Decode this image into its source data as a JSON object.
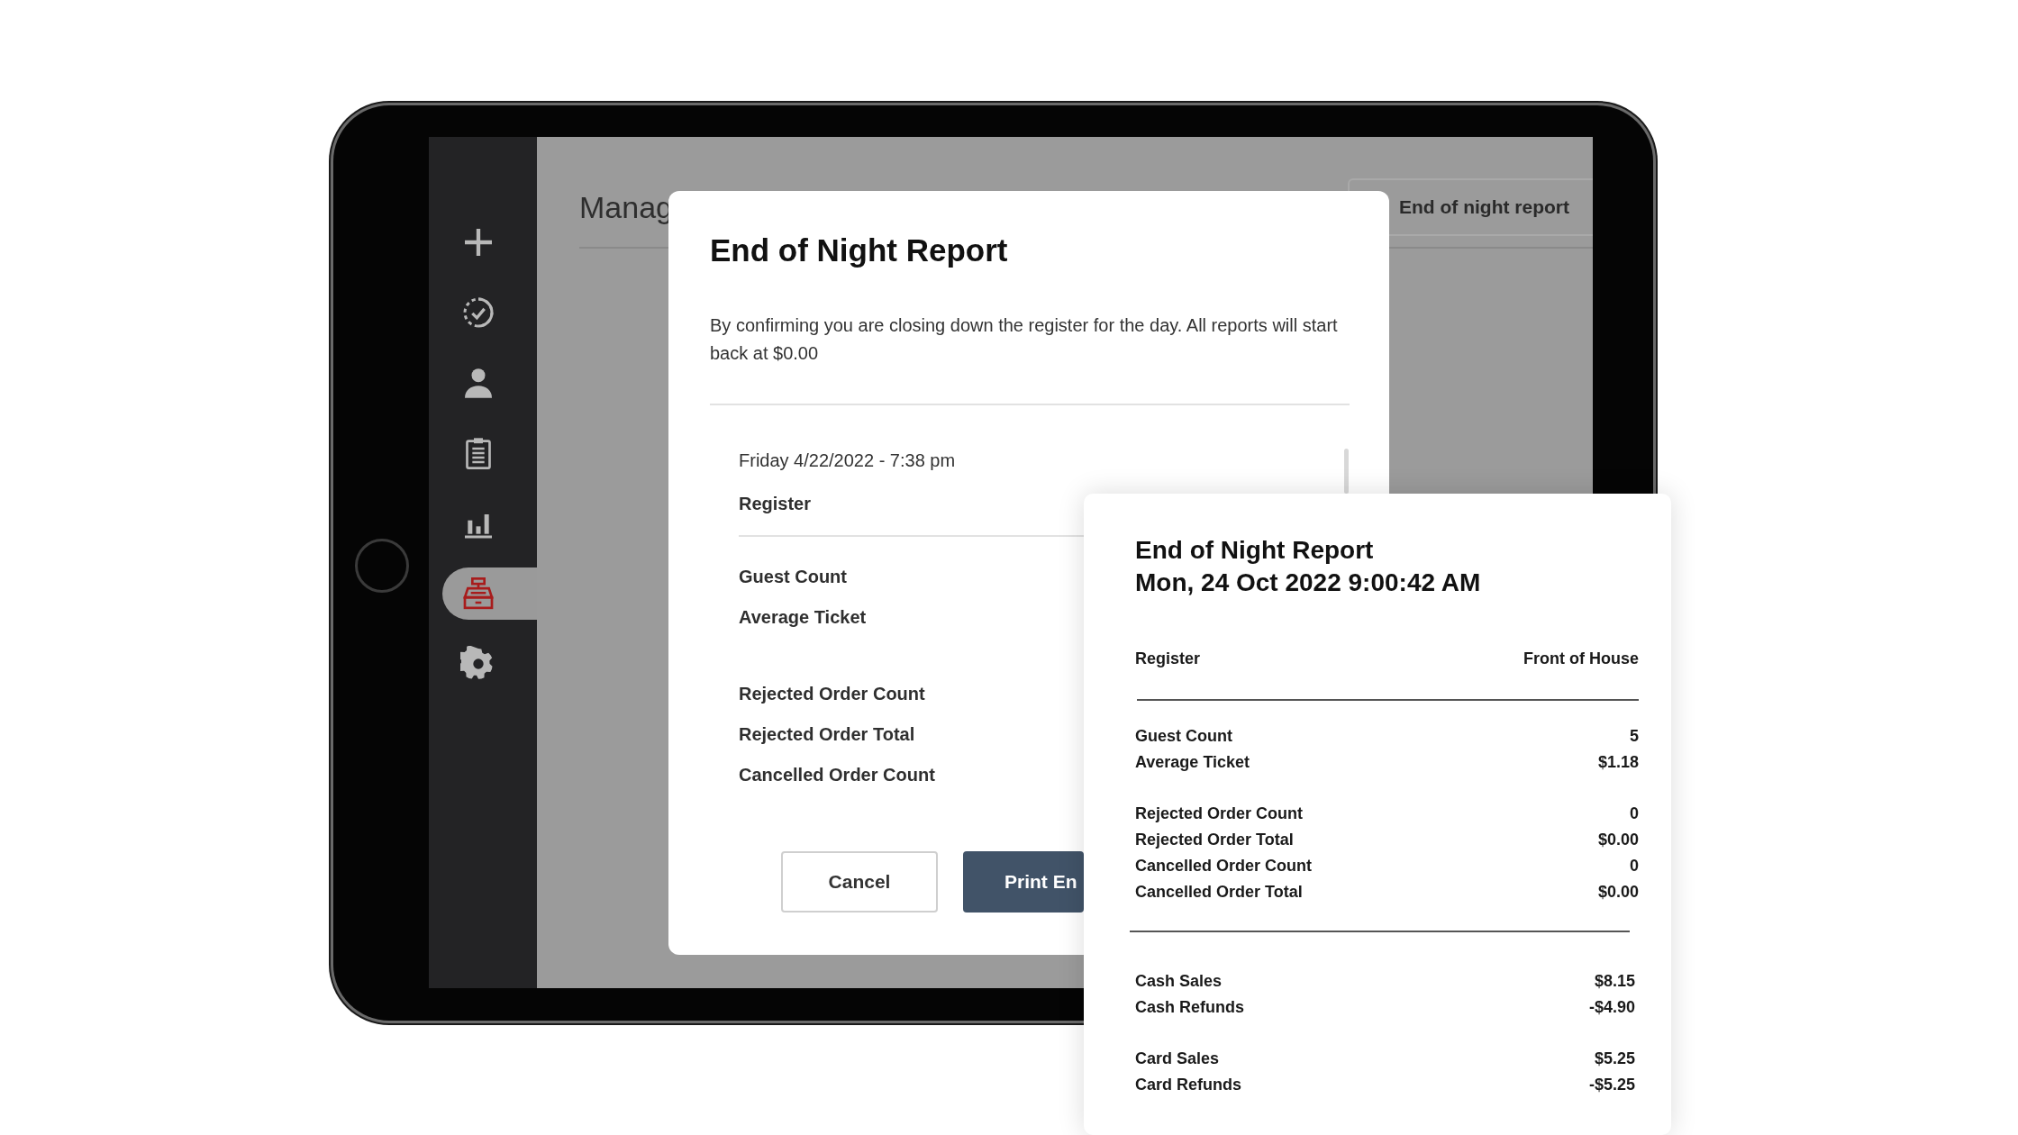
{
  "sidebar": {
    "items": [
      {
        "kind": "plus",
        "selected": false
      },
      {
        "kind": "progress",
        "selected": false
      },
      {
        "kind": "person",
        "selected": false
      },
      {
        "kind": "clipboard",
        "selected": false
      },
      {
        "kind": "chart",
        "selected": false
      },
      {
        "kind": "register",
        "selected": true
      },
      {
        "kind": "gear",
        "selected": false
      }
    ]
  },
  "page": {
    "title": "Manag",
    "action_button": "End of night report"
  },
  "modal": {
    "title": "End of Night Report",
    "message": "By confirming you are closing down the register for the day. All reports will start back at $0.00",
    "date": "Friday 4/22/2022 - 7:38 pm",
    "register_label": "Register",
    "groups": [
      [
        "Guest Count",
        "Average Ticket"
      ],
      [
        "Rejected Order Count",
        "Rejected Order Total",
        "Cancelled Order Count"
      ]
    ],
    "buttons": [
      {
        "label": "Cancel",
        "kind": "secondary"
      },
      {
        "label": "Print En",
        "kind": "primary"
      }
    ]
  },
  "receipt": {
    "title": "End of Night Report",
    "timestamp": "Mon, 24 Oct 2022 9:00:42 AM",
    "register": {
      "label": "Register",
      "value": "Front of House"
    },
    "sections": [
      {
        "groups": [
          [
            {
              "label": "Guest Count",
              "value": "5"
            },
            {
              "label": "Average Ticket",
              "value": "$1.18"
            }
          ],
          [
            {
              "label": "Rejected Order Count",
              "value": "0"
            },
            {
              "label": "Rejected Order Total",
              "value": "$0.00"
            },
            {
              "label": "Cancelled Order Count",
              "value": "0"
            },
            {
              "label": "Cancelled Order Total",
              "value": "$0.00"
            }
          ]
        ]
      },
      {
        "groups": [
          [
            {
              "label": "Cash Sales",
              "value": "$8.15"
            },
            {
              "label": "Cash Refunds",
              "value": "-$4.90"
            }
          ],
          [
            {
              "label": "Card Sales",
              "value": "$5.25"
            },
            {
              "label": "Card Refunds",
              "value": "-$5.25"
            }
          ]
        ]
      }
    ]
  }
}
